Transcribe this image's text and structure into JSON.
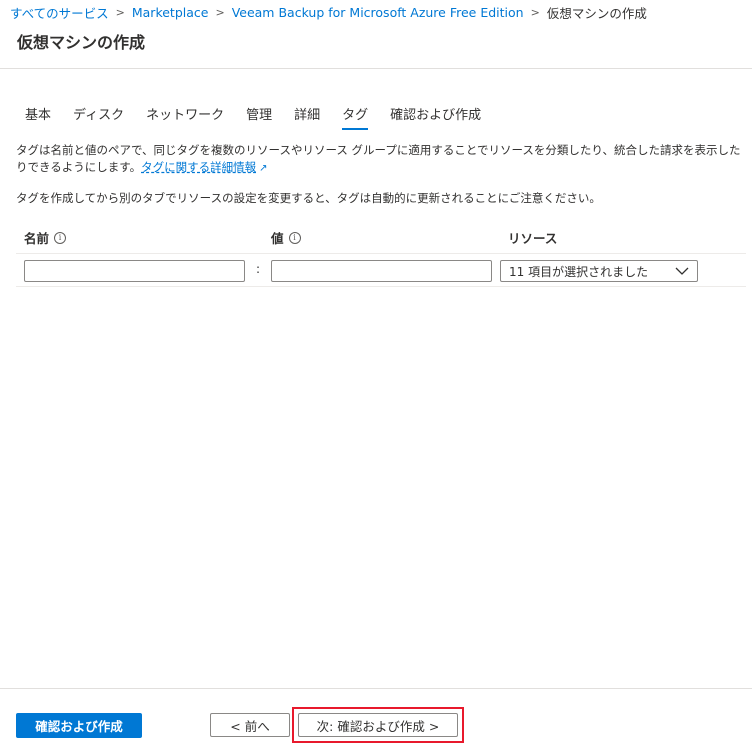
{
  "breadcrumb": {
    "items": [
      "すべてのサービス",
      "Marketplace",
      "Veeam Backup for Microsoft Azure Free Edition"
    ],
    "current": "仮想マシンの作成"
  },
  "page": {
    "title": "仮想マシンの作成"
  },
  "tabs": [
    {
      "label": "基本",
      "active": false
    },
    {
      "label": "ディスク",
      "active": false
    },
    {
      "label": "ネットワーク",
      "active": false
    },
    {
      "label": "管理",
      "active": false
    },
    {
      "label": "詳細",
      "active": false
    },
    {
      "label": "タグ",
      "active": true
    },
    {
      "label": "確認および作成",
      "active": false
    }
  ],
  "description": {
    "paragraph1": "タグは名前と値のペアで、同じタグを複数のリソースやリソース グループに適用することでリソースを分類したり、統合した請求を表示したりできるようにします。",
    "link": "タグに関する詳細情報",
    "paragraph2": "タグを作成してから別のタブでリソースの設定を変更すると、タグは自動的に更新されることにご注意ください。"
  },
  "table": {
    "headers": {
      "name": "名前",
      "value": "値",
      "resource": "リソース"
    },
    "row": {
      "name_value": "",
      "value_value": "",
      "separator": ":",
      "resource_selected": "11 項目が選択されました"
    }
  },
  "footer": {
    "review_create": "確認および作成",
    "previous": "< 前へ",
    "next": "次: 確認および作成 >"
  },
  "colors": {
    "accent": "#0078d4",
    "highlight": "#e8192c"
  },
  "icons": {
    "breadcrumb_separator": "chevron-right-icon",
    "info": "info-icon",
    "external_link": "external-link-icon",
    "dropdown": "chevron-down-icon"
  }
}
